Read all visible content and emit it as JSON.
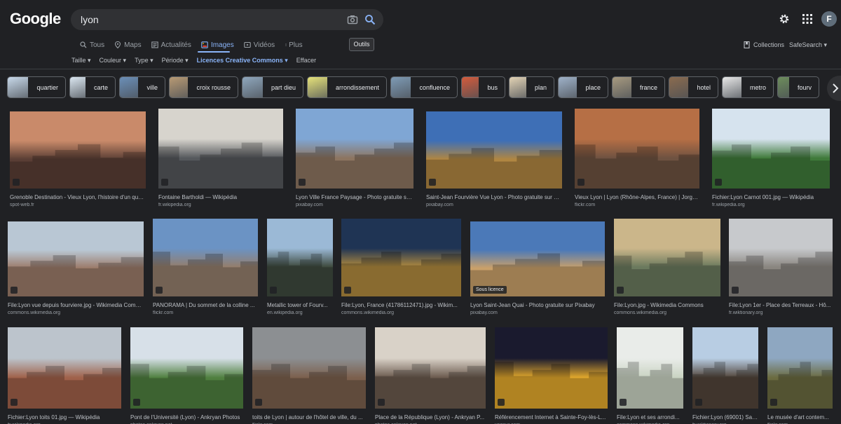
{
  "logo": "Google",
  "search": {
    "query": "lyon"
  },
  "user": {
    "initial": "F"
  },
  "tabs": [
    {
      "label": "Tous",
      "icon": "search-icon"
    },
    {
      "label": "Maps",
      "icon": "pin-icon"
    },
    {
      "label": "Actualités",
      "icon": "news-icon"
    },
    {
      "label": "Images",
      "icon": "image-icon"
    },
    {
      "label": "Vidéos",
      "icon": "video-icon"
    },
    {
      "label": "Plus",
      "icon": "more-vert-icon"
    }
  ],
  "tools_label": "Outils",
  "collections_label": "Collections",
  "safesearch_label": "SafeSearch ▾",
  "filters": [
    {
      "label": "Taille ▾"
    },
    {
      "label": "Couleur ▾"
    },
    {
      "label": "Type ▾"
    },
    {
      "label": "Période ▾"
    },
    {
      "label": "Licences Creative Commons ▾"
    },
    {
      "label": "Effacer"
    }
  ],
  "chips": [
    {
      "label": "quartier",
      "color": "#c8d9ea"
    },
    {
      "label": "carte",
      "color": "#dbe7f1"
    },
    {
      "label": "ville",
      "color": "#6b8fb8"
    },
    {
      "label": "croix rousse",
      "color": "#b89a74"
    },
    {
      "label": "part dieu",
      "color": "#8fa7bd"
    },
    {
      "label": "arrondissement",
      "color": "#e6e27a"
    },
    {
      "label": "confluence",
      "color": "#7e9bb5"
    },
    {
      "label": "bus",
      "color": "#d45b3c"
    },
    {
      "label": "plan",
      "color": "#e3d3b5"
    },
    {
      "label": "place",
      "color": "#9fb2c9"
    },
    {
      "label": "france",
      "color": "#a79a80"
    },
    {
      "label": "hotel",
      "color": "#8a6b4f"
    },
    {
      "label": "metro",
      "color": "#e8e8e8"
    },
    {
      "label": "fourv",
      "color": "#6d8d5c"
    }
  ],
  "results": [
    {
      "title": "Grenoble Destination - Vieux Lyon, l'histoire d'un quar...",
      "source": "spot-web.fr",
      "sky": "#c98a6a",
      "ground": "#5a3e35"
    },
    {
      "title": "Fontaine Bartholdi — Wikipédia",
      "source": "fr.wikipedia.org",
      "sky": "#d7d4cd",
      "ground": "#55585c"
    },
    {
      "title": "Lyon Ville France Paysage - Photo gratuite sur...",
      "source": "pixabay.com",
      "sky": "#7fa6d4",
      "ground": "#8d7560"
    },
    {
      "title": "Saint-Jean Fourvière Vue Lyon - Photo gratuite sur Pi...",
      "source": "pixabay.com",
      "sky": "#3e6fb6",
      "ground": "#b08642"
    },
    {
      "title": "Vieux Lyon | Lyon (Rhône-Alpes, France) | Jorge ...",
      "source": "flickr.com",
      "sky": "#b66f45",
      "ground": "#6e5241"
    },
    {
      "title": "Fichier:Lyon Carnot 001.jpg — Wikipédia",
      "source": "fr.wikipedia.org",
      "sky": "#d6e3ee",
      "ground": "#3f7a3a"
    },
    {
      "title": "File:Lyon vue depuis fourviere.jpg - Wikimedia Comm...",
      "source": "commons.wikimedia.org",
      "sky": "#b9c7d4",
      "ground": "#9c7b6a"
    },
    {
      "title": "PANORAMA | Du sommet de la colline ...",
      "source": "flickr.com",
      "sky": "#6b93c4",
      "ground": "#947e6c"
    },
    {
      "title": "Metallic tower of Fourv...",
      "source": "en.wikipedia.org",
      "sky": "#9bb9d6",
      "ground": "#3e4a3e"
    },
    {
      "title": "File:Lyon, France (41786112471).jpg - Wikim...",
      "source": "commons.wikimedia.org",
      "sky": "#1f3454",
      "ground": "#b08a3e"
    },
    {
      "title": "Lyon Saint-Jean Quai - Photo gratuite sur Pixabay",
      "source": "pixabay.com",
      "sky": "#4b79b8",
      "ground": "#c9a06a",
      "badge": "Sous licence"
    },
    {
      "title": "File:Lyon.jpg - Wikimedia Commons",
      "source": "commons.wikimedia.org",
      "sky": "#cbb68a",
      "ground": "#6b7a5e"
    },
    {
      "title": "File:Lyon 1er - Place des Terreaux - Hô...",
      "source": "fr.wiktionary.org",
      "sky": "#c7c9cc",
      "ground": "#8a8680"
    },
    {
      "title": "Fichier:Lyon toits 01.jpg — Wikipédia",
      "source": "fr.wikipedia.org",
      "sky": "#bcc4cc",
      "ground": "#a0614a"
    },
    {
      "title": "Pont de l'Université (Lyon) - Ankryan Photos",
      "source": "photos.ankryan.net",
      "sky": "#d7e0e8",
      "ground": "#4f7f3f"
    },
    {
      "title": "toits de Lyon | autour de l'hôtel de ville, du ...",
      "source": "flickr.com",
      "sky": "#8c8f92",
      "ground": "#7c604d"
    },
    {
      "title": "Place de la République (Lyon) - Ankryan P...",
      "source": "photos.ankryan.net",
      "sky": "#d9d2c8",
      "ground": "#6b5a4e"
    },
    {
      "title": "Référencement Internet à Sainte-Foy-lès-L...",
      "source": "yagaur.com",
      "sky": "#1a1a2e",
      "ground": "#e2a82c"
    },
    {
      "title": "File:Lyon et ses arrondi...",
      "source": "commons.wikimedia.org",
      "sky": "#e9ece9",
      "ground": "#c9d3c2"
    },
    {
      "title": "Fichier:Lyon (69001) Saint...",
      "source": "fr.wiktionary.org",
      "sky": "#b8cde3",
      "ground": "#52453a"
    },
    {
      "title": "Le musée d'art contem...",
      "source": "flickr.com",
      "sky": "#8ea7c1",
      "ground": "#6b6b40"
    }
  ]
}
